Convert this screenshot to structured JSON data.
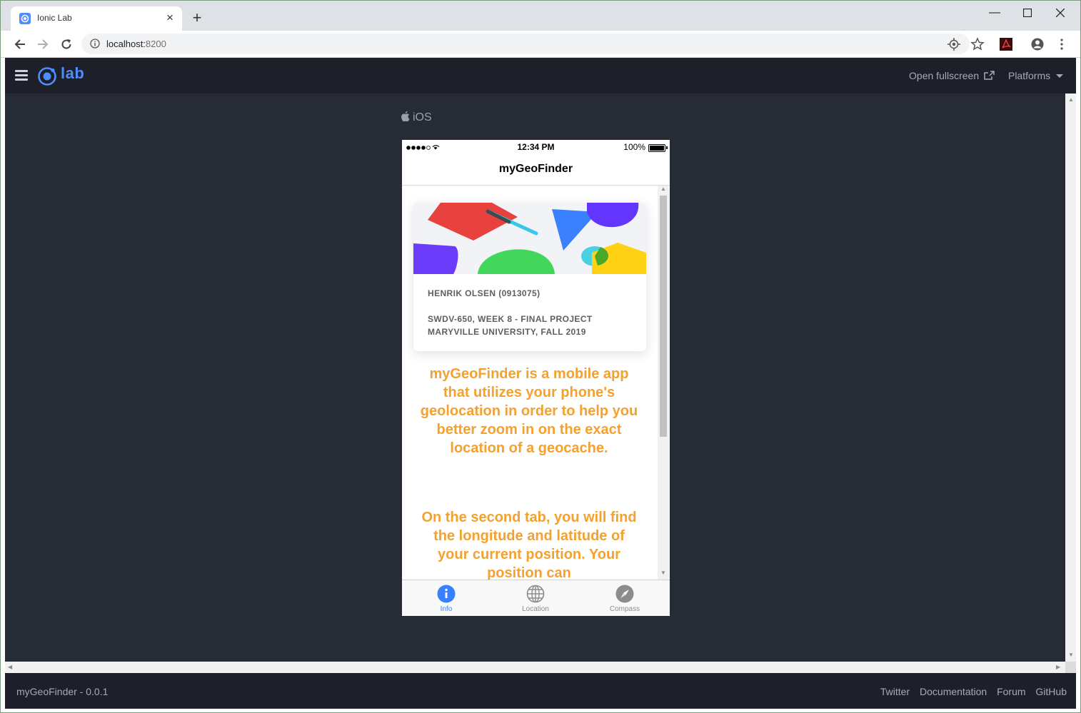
{
  "browser": {
    "tab_title": "Ionic Lab",
    "url_host": "localhost:",
    "url_port": "8200"
  },
  "lab": {
    "logo_text": "lab",
    "open_fullscreen": "Open fullscreen",
    "platforms": "Platforms",
    "platform_label": "iOS",
    "version": "myGeoFinder - 0.0.1",
    "footer_links": [
      "Twitter",
      "Documentation",
      "Forum",
      "GitHub"
    ]
  },
  "phone": {
    "time": "12:34 PM",
    "battery": "100%",
    "title": "myGeoFinder",
    "card": {
      "line1": "HENRIK OLSEN (0913075)",
      "line2": "SWDV-650, WEEK 8 - FINAL PROJECT",
      "line3": "MARYVILLE UNIVERSITY, FALL 2019"
    },
    "desc1": "myGeoFinder is a mobile app that utilizes your phone's geolocation in order to help you better zoom in on the exact location of a geocache.",
    "desc2": "On the second tab, you will find the longitude and latitude of your current position. Your position can",
    "tabs": [
      {
        "label": "Info",
        "icon": "info-icon"
      },
      {
        "label": "Location",
        "icon": "globe-icon"
      },
      {
        "label": "Compass",
        "icon": "compass-icon"
      }
    ]
  },
  "colors": {
    "accent": "#4d8dff",
    "desc_text": "#f4a12f",
    "dark_bg": "#272b33",
    "header_bg": "#1d2028"
  }
}
